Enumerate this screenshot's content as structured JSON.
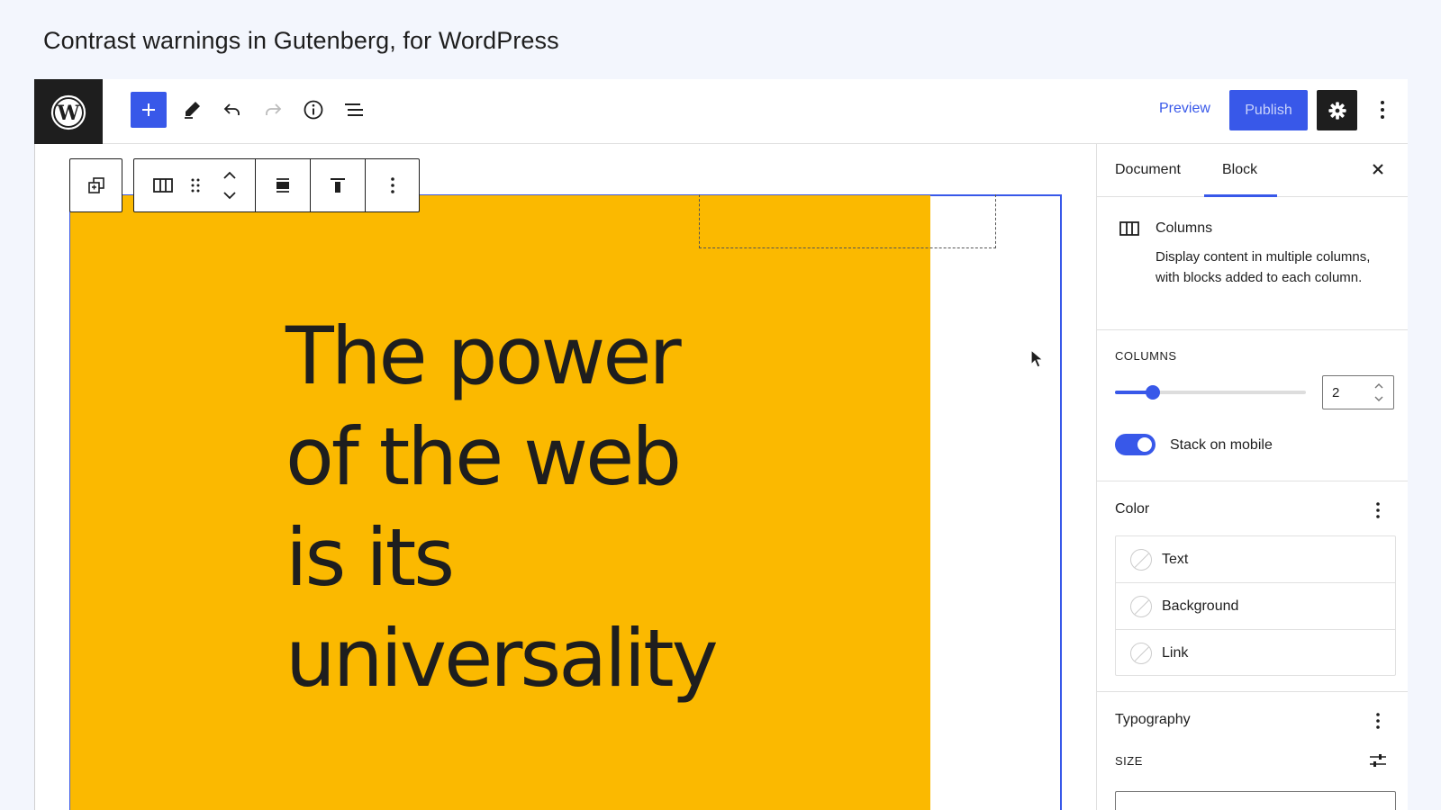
{
  "caption": "Contrast warnings in Gutenberg, for WordPress",
  "topbar": {
    "preview_label": "Preview",
    "publish_label": "Publish",
    "icons": [
      "wordpress-logo-icon",
      "plus-icon",
      "pencil-icon",
      "undo-icon",
      "redo-icon",
      "info-icon",
      "list-view-icon",
      "gear-icon",
      "more-vertical-icon"
    ]
  },
  "canvas": {
    "hero_lines": [
      "The power",
      "of the web",
      "is its",
      "universality"
    ],
    "column_color": "#fbb900",
    "accent": "#3858e9"
  },
  "block_toolbar": {
    "icons": [
      "select-parent-icon",
      "columns-icon",
      "drag-handle-icon",
      "move-up-down-icon",
      "align-center-icon",
      "align-top-icon",
      "more-vertical-icon"
    ]
  },
  "sidebar": {
    "tabs": [
      "Document",
      "Block"
    ],
    "active_tab": "Block",
    "block_card": {
      "title": "Columns",
      "description": "Display content in multiple columns, with blocks added to each column."
    },
    "columns_section": {
      "label": "Columns",
      "value": "2",
      "slider_fraction": 0.2,
      "stack_label": "Stack on mobile",
      "stack_on": true
    },
    "color_section": {
      "title": "Color",
      "items": [
        "Text",
        "Background",
        "Link"
      ]
    },
    "typography_section": {
      "title": "Typography",
      "size_label": "Size"
    }
  }
}
